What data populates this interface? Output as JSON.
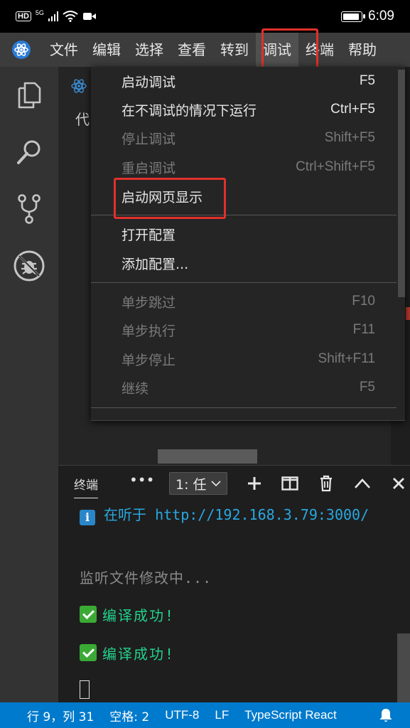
{
  "status_bar": {
    "hd_label": "HD",
    "network_label": "5G",
    "time": "6:09"
  },
  "menubar": {
    "items": [
      "文件",
      "编辑",
      "选择",
      "查看",
      "转到",
      "调试",
      "终端",
      "帮助"
    ],
    "active_item": "调试",
    "highlight_color": "#e0312b"
  },
  "editor": {
    "partial_text": "代"
  },
  "debug_menu": {
    "groups": [
      [
        {
          "label": "启动调试",
          "shortcut": "F5",
          "enabled": true
        },
        {
          "label": "在不调试的情况下运行",
          "shortcut": "Ctrl+F5",
          "enabled": true
        },
        {
          "label": "停止调试",
          "shortcut": "Shift+F5",
          "enabled": false
        },
        {
          "label": "重启调试",
          "shortcut": "Ctrl+Shift+F5",
          "enabled": false
        },
        {
          "label": "启动网页显示",
          "shortcut": "",
          "enabled": true,
          "highlighted": true
        }
      ],
      [
        {
          "label": "打开配置",
          "shortcut": "",
          "enabled": true
        },
        {
          "label": "添加配置...",
          "shortcut": "",
          "enabled": true
        }
      ],
      [
        {
          "label": "单步跳过",
          "shortcut": "F10",
          "enabled": false
        },
        {
          "label": "单步执行",
          "shortcut": "F11",
          "enabled": false
        },
        {
          "label": "单步停止",
          "shortcut": "Shift+F11",
          "enabled": false
        },
        {
          "label": "继续",
          "shortcut": "F5",
          "enabled": false
        }
      ]
    ]
  },
  "panel": {
    "title": "终端",
    "more": "•••",
    "terminal_select": "1: 任",
    "buttons": [
      "plus-icon",
      "split-icon",
      "trash-icon",
      "chevron-up-icon",
      "close-icon"
    ]
  },
  "terminal": {
    "info_badge": "i",
    "info_text": "在听于 http://192.168.3.79:3000/",
    "watch_text": "监听文件修改中...",
    "success_1": "编译成功!",
    "success_2": "编译成功!"
  },
  "vs_status": {
    "position": "行 9，列 31",
    "spaces": "空格: 2",
    "encoding": "UTF-8",
    "eol": "LF",
    "language": "TypeScript React"
  },
  "colors": {
    "accent": "#007acc",
    "success": "#23d18b",
    "info": "#29a8e0",
    "highlight": "#e0312b"
  }
}
